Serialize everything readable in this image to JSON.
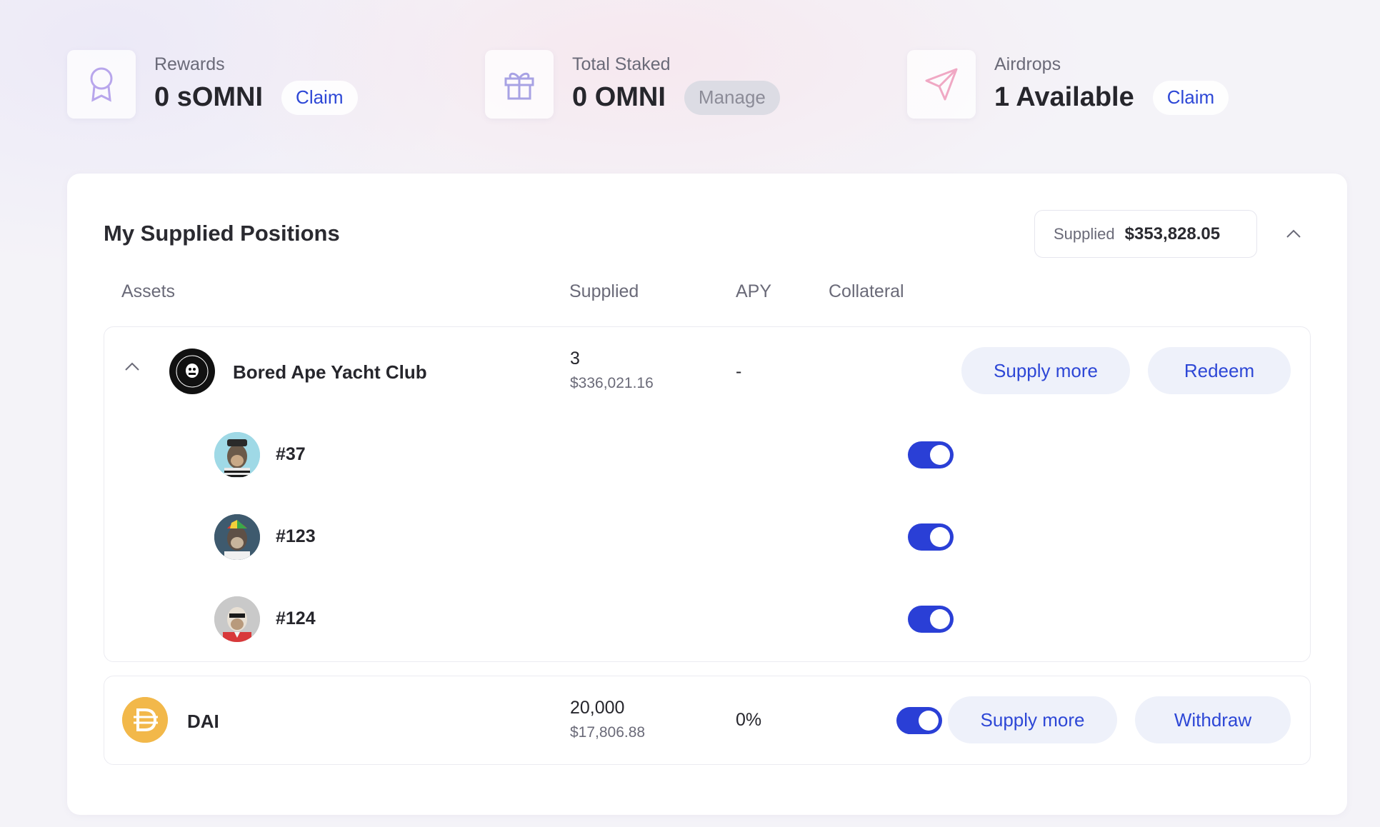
{
  "stats": {
    "rewards": {
      "label": "Rewards",
      "value": "0 sOMNI",
      "action": "Claim",
      "icon": "award-ribbon-icon"
    },
    "staked": {
      "label": "Total Staked",
      "value": "0 OMNI",
      "action": "Manage",
      "icon": "gift-icon"
    },
    "airdrops": {
      "label": "Airdrops",
      "value": "1 Available",
      "action": "Claim",
      "icon": "send-plane-icon"
    }
  },
  "positions": {
    "title": "My Supplied Positions",
    "supplied_label": "Supplied",
    "supplied_total": "$353,828.05",
    "columns": {
      "assets": "Assets",
      "supplied": "Supplied",
      "apy": "APY",
      "collateral": "Collateral"
    },
    "bayc": {
      "name": "Bored Ape Yacht Club",
      "amount": "3",
      "usd": "$336,021.16",
      "apy": "-",
      "supply_more": "Supply more",
      "redeem": "Redeem",
      "nfts": [
        {
          "id": "#37",
          "collateral": true
        },
        {
          "id": "#123",
          "collateral": true
        },
        {
          "id": "#124",
          "collateral": true
        }
      ]
    },
    "dai": {
      "name": "DAI",
      "amount": "20,000",
      "usd": "$17,806.88",
      "apy": "0%",
      "collateral": true,
      "supply_more": "Supply more",
      "withdraw": "Withdraw"
    }
  },
  "colors": {
    "accent": "#2d47d6",
    "toggle_on": "#2a3fd6",
    "dai": "#f2b84a"
  }
}
